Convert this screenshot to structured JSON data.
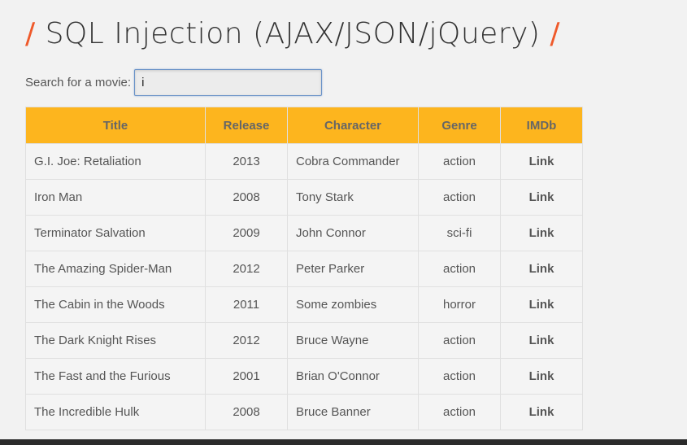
{
  "page": {
    "title": "SQL Injection (AJAX/JSON/jQuery)",
    "slash": "/"
  },
  "search": {
    "label": "Search for a movie:",
    "value": "i"
  },
  "table": {
    "headers": [
      "Title",
      "Release",
      "Character",
      "Genre",
      "IMDb"
    ],
    "rows": [
      {
        "title": "G.I. Joe: Retaliation",
        "release": "2013",
        "character": "Cobra Commander",
        "genre": "action",
        "imdb": "Link"
      },
      {
        "title": "Iron Man",
        "release": "2008",
        "character": "Tony Stark",
        "genre": "action",
        "imdb": "Link"
      },
      {
        "title": "Terminator Salvation",
        "release": "2009",
        "character": "John Connor",
        "genre": "sci-fi",
        "imdb": "Link"
      },
      {
        "title": "The Amazing Spider-Man",
        "release": "2012",
        "character": "Peter Parker",
        "genre": "action",
        "imdb": "Link"
      },
      {
        "title": "The Cabin in the Woods",
        "release": "2011",
        "character": "Some zombies",
        "genre": "horror",
        "imdb": "Link"
      },
      {
        "title": "The Dark Knight Rises",
        "release": "2012",
        "character": "Bruce Wayne",
        "genre": "action",
        "imdb": "Link"
      },
      {
        "title": "The Fast and the Furious",
        "release": "2001",
        "character": "Brian O'Connor",
        "genre": "action",
        "imdb": "Link"
      },
      {
        "title": "The Incredible Hulk",
        "release": "2008",
        "character": "Bruce Banner",
        "genre": "action",
        "imdb": "Link"
      }
    ]
  },
  "colors": {
    "accent_slash": "#ef5a2b",
    "header_bg": "#fdb51e",
    "input_border": "#6a93c8"
  }
}
